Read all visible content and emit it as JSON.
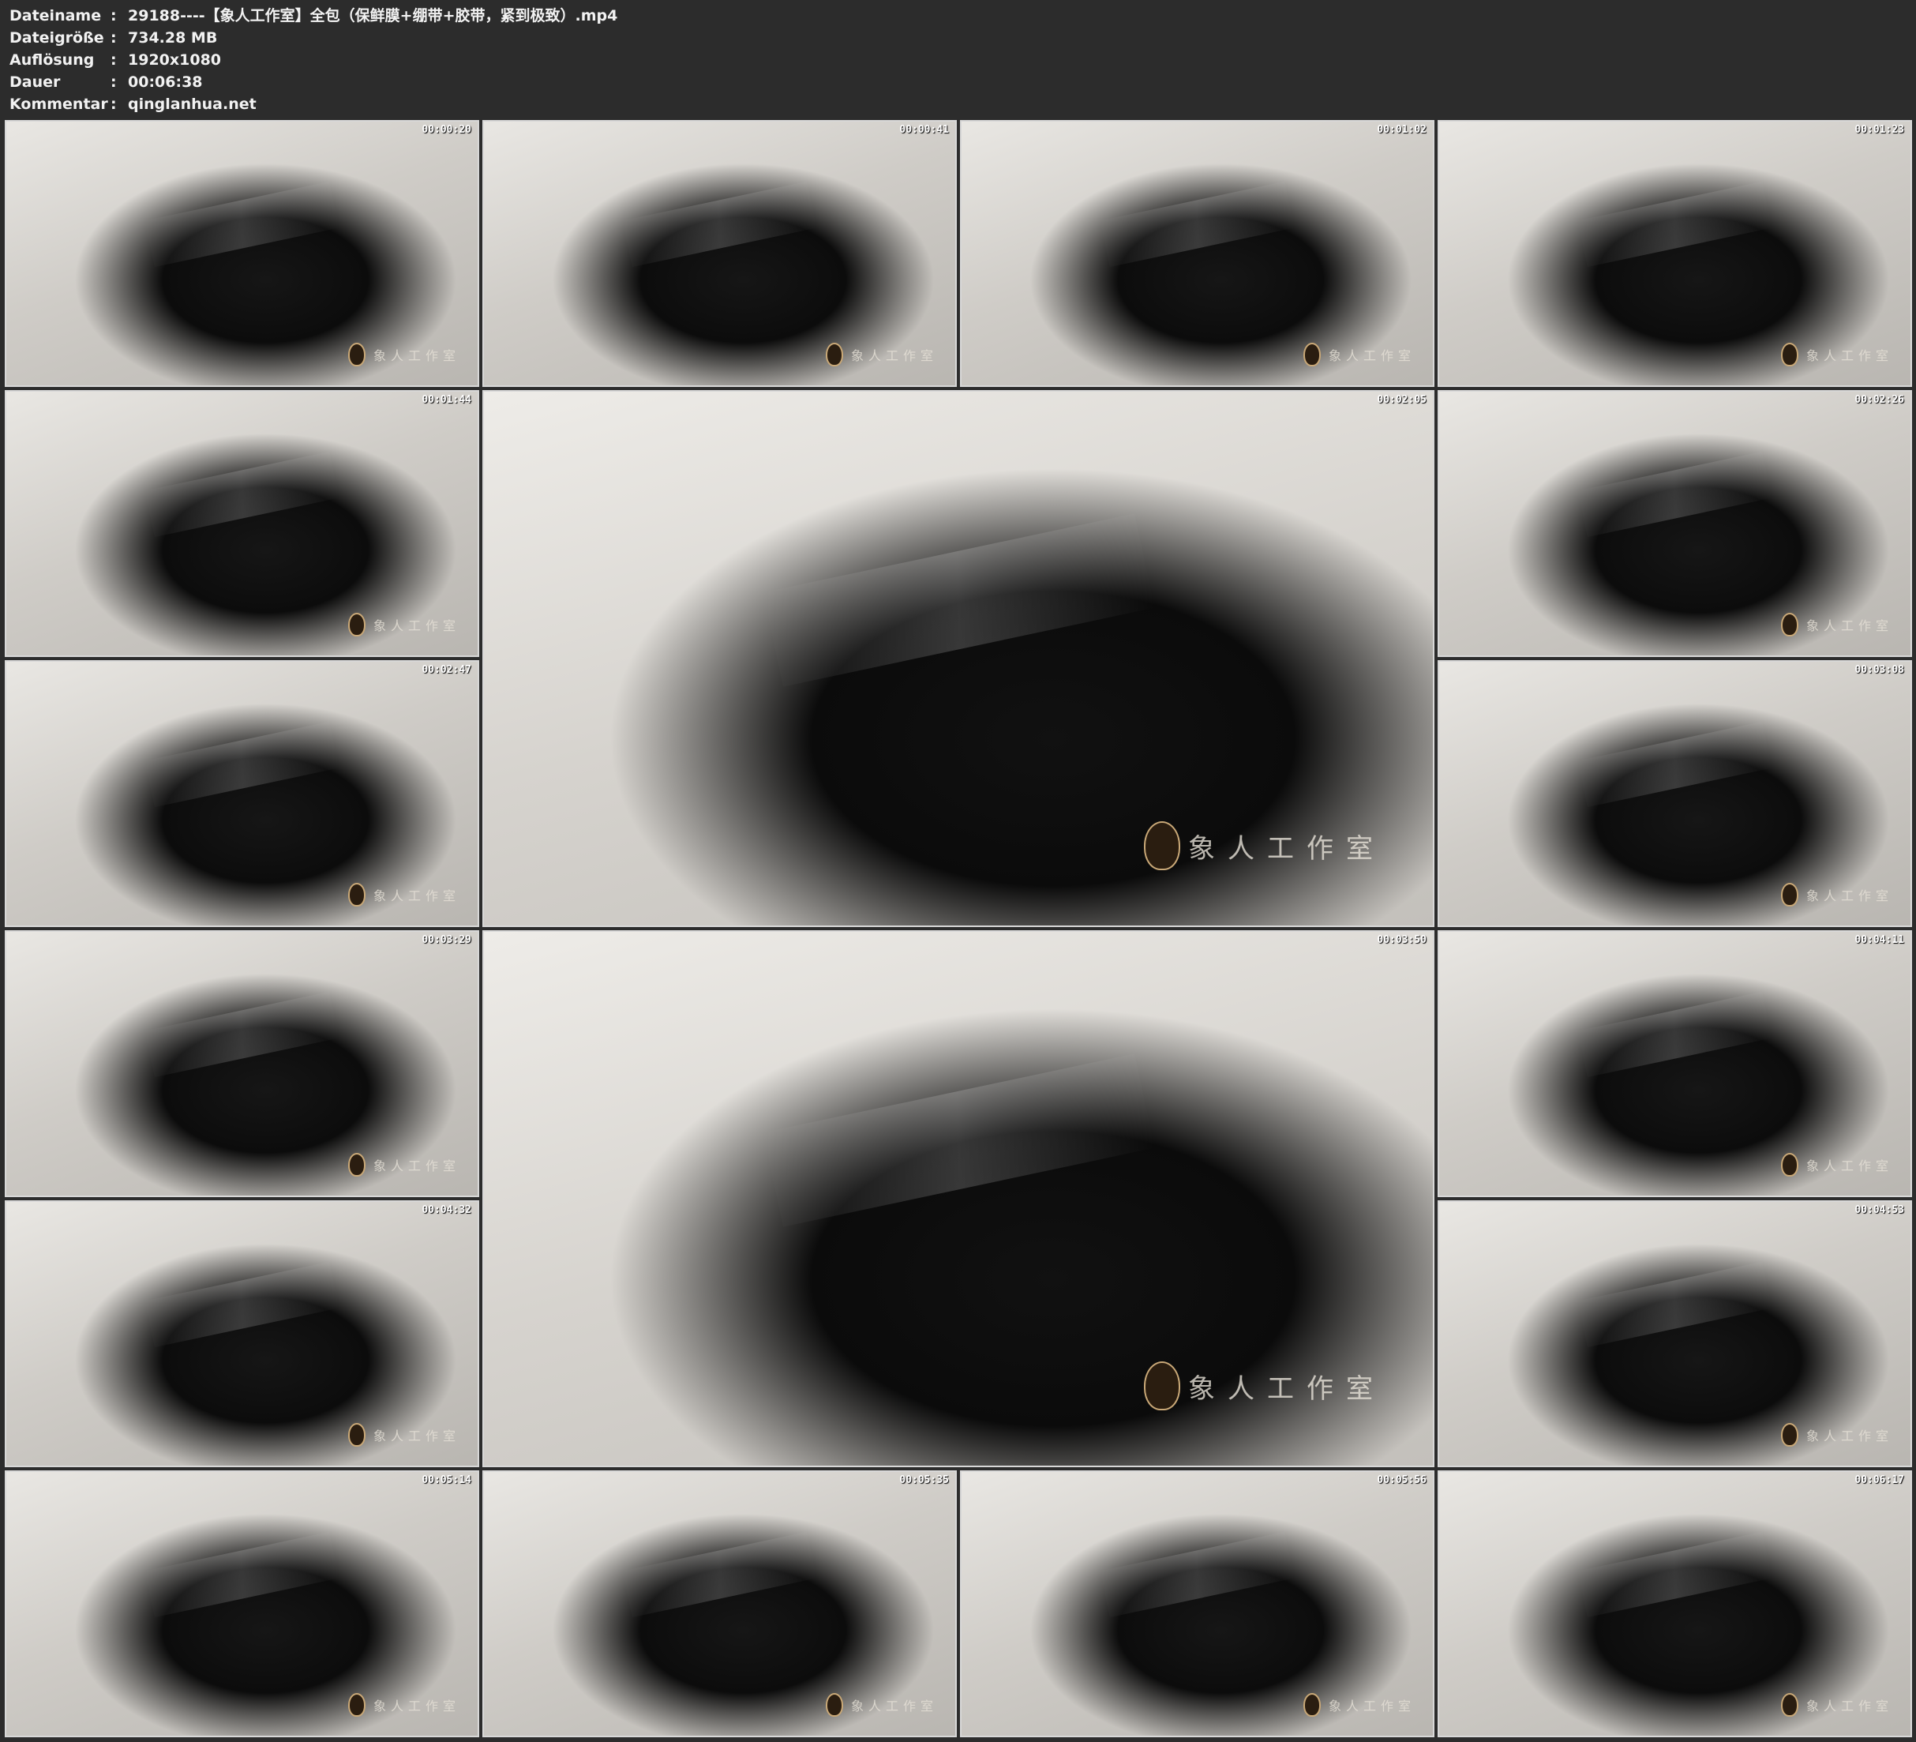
{
  "header": {
    "rows": [
      {
        "key": "Dateiname",
        "value": "29188----【象人工作室】全包（保鲜膜+绷带+胶带，紧到极致）.mp4"
      },
      {
        "key": "Dateigröße",
        "value": "734.28 MB"
      },
      {
        "key": "Auflösung",
        "value": "1920x1080"
      },
      {
        "key": "Dauer",
        "value": "00:06:38"
      },
      {
        "key": "Kommentar",
        "value": "qinglanhua.net"
      }
    ],
    "separator": ":"
  },
  "watermark_text": "象人工作室",
  "thumbnails": [
    {
      "time": "00:00:20",
      "icon": "studio-logo-icon"
    },
    {
      "time": "00:00:41",
      "icon": "studio-logo-icon"
    },
    {
      "time": "00:01:02",
      "icon": "studio-logo-icon"
    },
    {
      "time": "00:01:23",
      "icon": "studio-logo-icon"
    },
    {
      "time": "00:01:44",
      "icon": "studio-logo-icon"
    },
    {
      "time": "00:02:05",
      "icon": "studio-logo-icon"
    },
    {
      "time": "00:02:26",
      "icon": "studio-logo-icon"
    },
    {
      "time": "00:02:47",
      "icon": "studio-logo-icon"
    },
    {
      "time": "00:03:08",
      "icon": "studio-logo-icon"
    },
    {
      "time": "00:03:29",
      "icon": "studio-logo-icon"
    },
    {
      "time": "00:03:50",
      "icon": "studio-logo-icon"
    },
    {
      "time": "00:04:11",
      "icon": "studio-logo-icon"
    },
    {
      "time": "00:04:32",
      "icon": "studio-logo-icon"
    },
    {
      "time": "00:04:53",
      "icon": "studio-logo-icon"
    },
    {
      "time": "00:05:14",
      "icon": "studio-logo-icon"
    },
    {
      "time": "00:05:35",
      "icon": "studio-logo-icon"
    },
    {
      "time": "00:05:56",
      "icon": "studio-logo-icon"
    },
    {
      "time": "00:06:17",
      "icon": "studio-logo-icon"
    }
  ]
}
